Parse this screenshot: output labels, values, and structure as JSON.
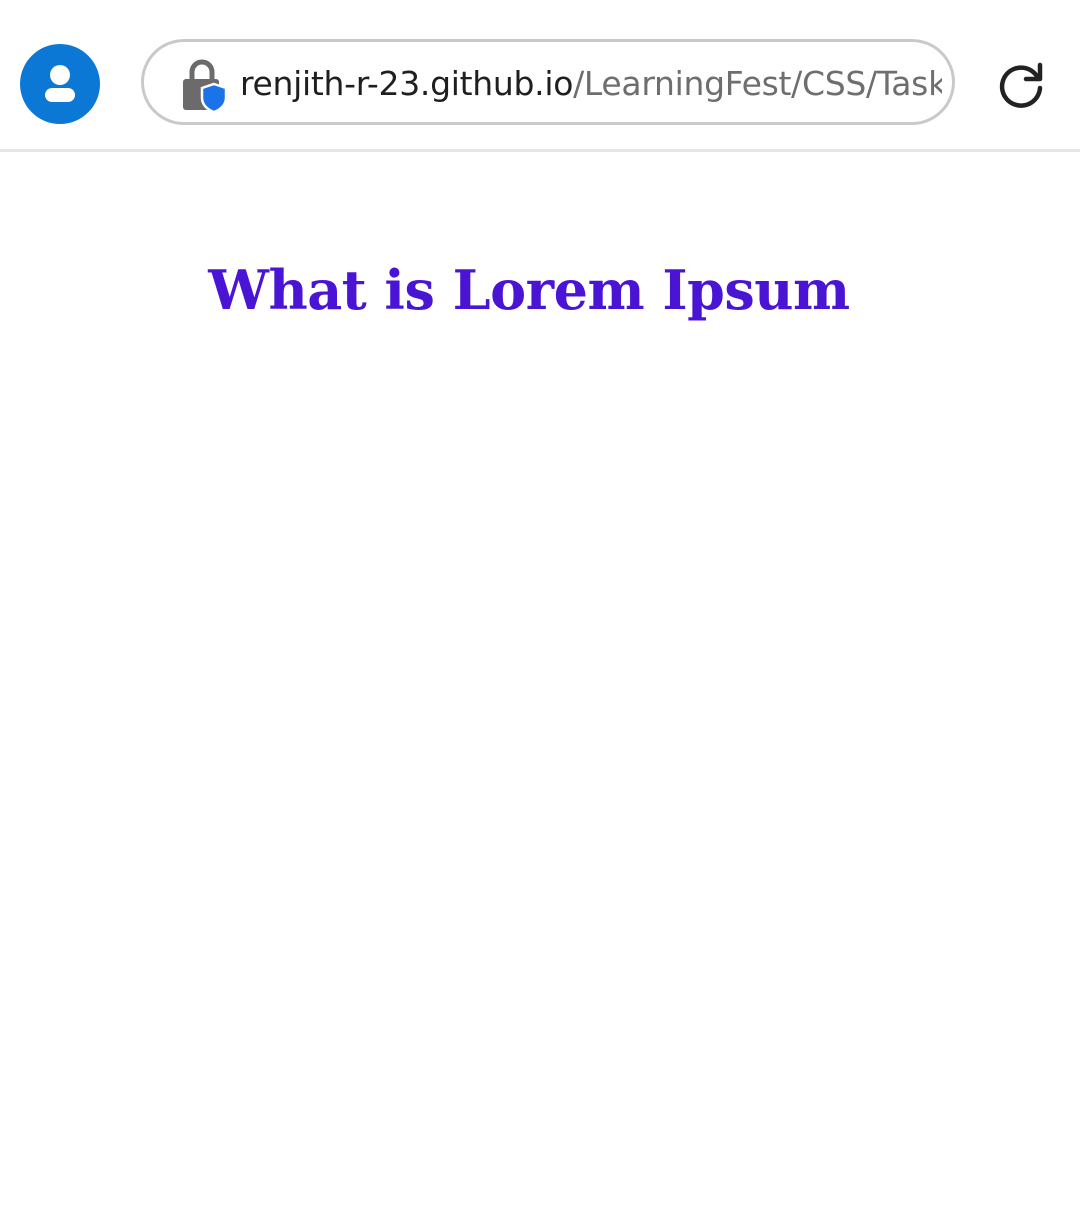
{
  "browser": {
    "address_bar": {
      "url_host": "renjith-r-23.github.io",
      "url_path": "/LearningFest/CSS/Task"
    },
    "icons": {
      "profile": "account-icon",
      "lock": "lock-shield-icon",
      "reload": "reload-icon"
    },
    "colors": {
      "profile_bg": "#0b78d6",
      "lock_shield": "#1a73e8"
    }
  },
  "page": {
    "heading": "What is Lorem Ipsum",
    "heading_color": "#4a14d4"
  }
}
